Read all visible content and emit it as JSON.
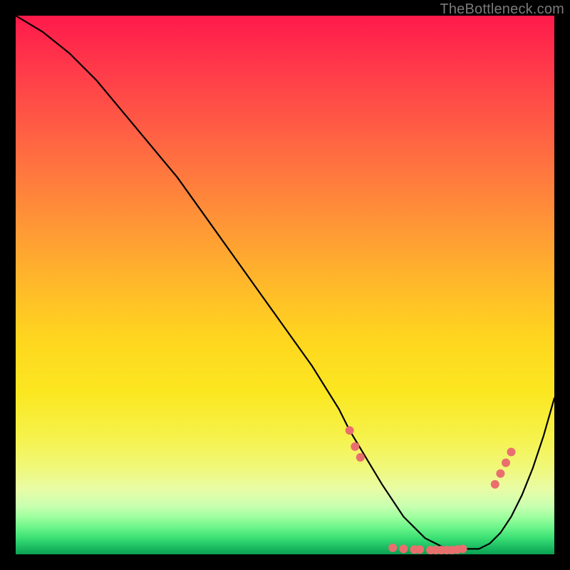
{
  "watermark": "TheBottleneck.com",
  "chart_data": {
    "type": "line",
    "title": "",
    "xlabel": "",
    "ylabel": "",
    "xlim": [
      0,
      100
    ],
    "ylim": [
      0,
      100
    ],
    "grid": false,
    "legend": false,
    "series": [
      {
        "name": "curve",
        "color": "#000000",
        "x": [
          0,
          5,
          10,
          15,
          20,
          25,
          30,
          35,
          40,
          45,
          50,
          55,
          60,
          62,
          65,
          68,
          70,
          72,
          74,
          76,
          78,
          80,
          82,
          84,
          86,
          88,
          90,
          92,
          94,
          96,
          98,
          100
        ],
        "y": [
          100,
          97,
          93,
          88,
          82,
          76,
          70,
          63,
          56,
          49,
          42,
          35,
          27,
          23,
          18,
          13,
          10,
          7,
          5,
          3,
          2,
          1,
          1,
          1,
          1,
          2,
          4,
          7,
          11,
          16,
          22,
          29
        ]
      }
    ],
    "markers": {
      "color": "#e96f6f",
      "radius_px": 6,
      "points": [
        {
          "x": 62,
          "y": 23
        },
        {
          "x": 63,
          "y": 20
        },
        {
          "x": 64,
          "y": 18
        },
        {
          "x": 70,
          "y": 1.2
        },
        {
          "x": 72,
          "y": 1.0
        },
        {
          "x": 74,
          "y": 0.9
        },
        {
          "x": 75,
          "y": 0.9
        },
        {
          "x": 77,
          "y": 0.8
        },
        {
          "x": 78,
          "y": 0.8
        },
        {
          "x": 79,
          "y": 0.8
        },
        {
          "x": 80,
          "y": 0.8
        },
        {
          "x": 81,
          "y": 0.8
        },
        {
          "x": 82,
          "y": 0.9
        },
        {
          "x": 83,
          "y": 1.0
        },
        {
          "x": 89,
          "y": 13
        },
        {
          "x": 90,
          "y": 15
        },
        {
          "x": 91,
          "y": 17
        },
        {
          "x": 92,
          "y": 19
        }
      ]
    }
  }
}
